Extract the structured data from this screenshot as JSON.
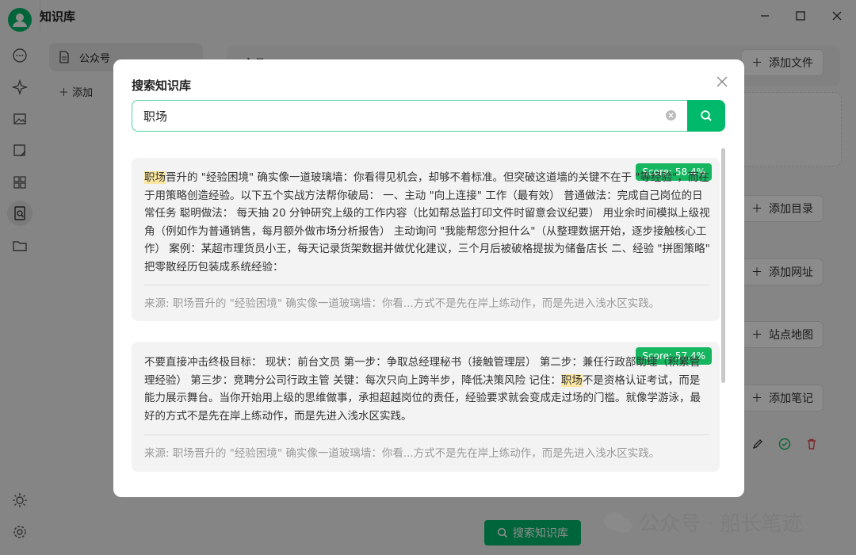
{
  "app": {
    "title": "知识库"
  },
  "sidebar": {
    "kb_item": "公众号",
    "add_label": "添加"
  },
  "main": {
    "file_section_title": "文件",
    "add_file": "添加文件",
    "add_dir": "添加目录",
    "add_url": "添加网址",
    "sitemap": "站点地图",
    "add_note": "添加笔记",
    "search_kb": "搜索知识库"
  },
  "watermark": "公众号 · 船长笔迹",
  "modal": {
    "title": "搜索知识库",
    "query": "职场",
    "results": [
      {
        "score": "Score: 58.4%",
        "highlight": "职场",
        "text": "晋升的 \"经验困境\" 确实像一道玻璃墙：你看得见机会，却够不着标准。但突破这道墙的关键不在于 \"等经验\"，而在于用策略创造经验。以下五个实战方法帮你破局： 一、主动 \"向上连接\" 工作（最有效） 普通做法：完成自己岗位的日常任务 聪明做法： 每天抽 20 分钟研究上级的工作内容（比如帮总监打印文件时留意会议纪要） 用业余时间模拟上级视角（例如作为普通销售，每月额外做市场分析报告） 主动询问 \"我能帮您分担什么\"（从整理数据开始，逐步接触核心工作） 案例：某超市理货员小王，每天记录货架数据并做优化建议，三个月后被破格提拔为储备店长 二、经验 \"拼图策略\" 把零散经历包装成系统经验：",
        "source": "来源: 职场晋升的 \"经验困境\" 确实像一道玻璃墙：你看...方式不是先在岸上练动作，而是先进入浅水区实践。"
      },
      {
        "score": "Score: 57.4%",
        "text_before": "不要直接冲击终极目标： 现状：前台文员 第一步：争取总经理秘书（接触管理层） 第二步：兼任行政部助理（积累管理经验） 第三步：竞聘分公司行政主管 关键：每次只向上跨半步，降低决策风险 记住：",
        "highlight": "职场",
        "text_after": "不是资格认证考试，而是能力展示舞台。当你开始用上级的思维做事，承担超越岗位的责任，经验要求就会变成走过场的门槛。就像学游泳，最好的方式不是先在岸上练动作，而是先进入浅水区实践。",
        "source": "来源: 职场晋升的 \"经验困境\" 确实像一道玻璃墙：你看...方式不是先在岸上练动作，而是先进入浅水区实践。"
      }
    ]
  },
  "colors": {
    "accent": "#00b96b",
    "score_badge": "#16b661",
    "highlight": "#fbe7a0"
  }
}
